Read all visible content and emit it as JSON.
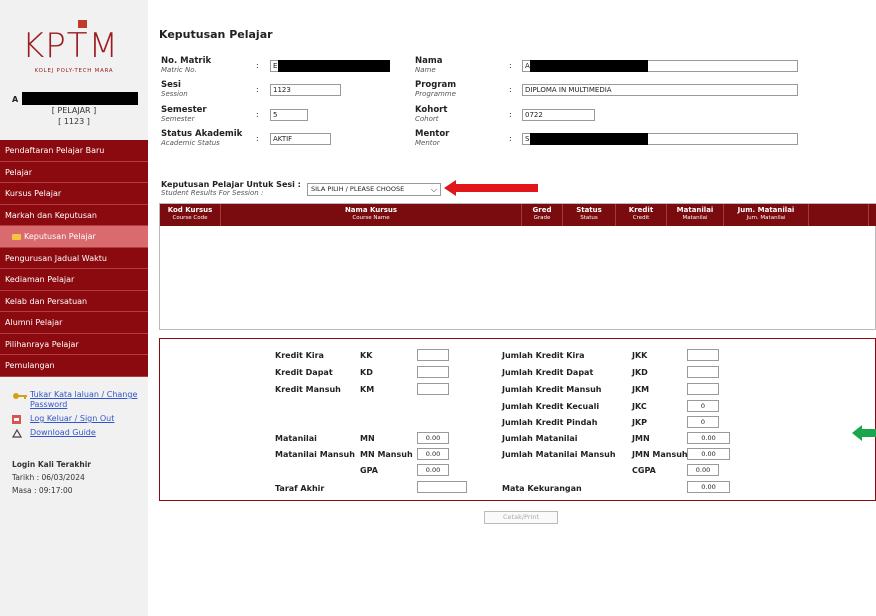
{
  "app": {
    "logo_text": "KPTM",
    "logo_sub": "KOLEJ POLY-TECH MARA"
  },
  "user": {
    "prefix": "A",
    "role": "[ PELAJAR ]",
    "session": "[ 1123 ]"
  },
  "nav": {
    "items": [
      {
        "label": "Pendaftaran Pelajar Baru"
      },
      {
        "label": "Pelajar"
      },
      {
        "label": "Kursus Pelajar"
      },
      {
        "label": "Markah dan Keputusan"
      },
      {
        "label": "Keputusan Pelajar"
      },
      {
        "label": "Pengurusan Jadual Waktu"
      },
      {
        "label": "Kediaman Pelajar"
      },
      {
        "label": "Kelab dan Persatuan"
      },
      {
        "label": "Alumni Pelajar"
      },
      {
        "label": "Pilihanraya Pelajar"
      },
      {
        "label": "Pemulangan"
      }
    ],
    "active_index": 4
  },
  "links": {
    "change_password": "Tukar Kata laluan / Change Password",
    "logout": "Log Keluar / Sign Out",
    "guide": "Download Guide"
  },
  "last_login": {
    "title": "Login Kali Terakhir",
    "date_label": "Tarikh",
    "date": ": 06/03/2024",
    "time_label": "Masa",
    "time": ": 09:17:00"
  },
  "page": {
    "title": "Keputusan Pelajar"
  },
  "profile": {
    "matrik": {
      "label": "No. Matrik",
      "sub": "Matric No.",
      "value": "E"
    },
    "sesi": {
      "label": "Sesi",
      "sub": "Session",
      "value": "1123"
    },
    "semester": {
      "label": "Semester",
      "sub": "Semester",
      "value": "5"
    },
    "status": {
      "label": "Status Akademik",
      "sub": "Academic Status",
      "value": "AKTIF"
    },
    "nama": {
      "label": "Nama",
      "sub": "Name",
      "value": "A"
    },
    "program": {
      "label": "Program",
      "sub": "Programme",
      "value": "DIPLOMA IN MULTIMEDIA"
    },
    "kohort": {
      "label": "Kohort",
      "sub": "Cohort",
      "value": "0722"
    },
    "mentor": {
      "label": "Mentor",
      "sub": "Mentor",
      "value": "S"
    },
    "colon": ":"
  },
  "session_select": {
    "label": "Keputusan Pelajar Untuk Sesi :",
    "sub": "Student Results For Session :",
    "selected": "SILA PILIH / PLEASE CHOOSE"
  },
  "results_table": {
    "columns": [
      {
        "label": "Kod Kursus",
        "sub": "Course Code"
      },
      {
        "label": "Nama Kursus",
        "sub": "Course Name"
      },
      {
        "label": "Gred",
        "sub": "Grade"
      },
      {
        "label": "Status",
        "sub": "Status"
      },
      {
        "label": "Kredit",
        "sub": "Credit"
      },
      {
        "label": "Matanilai",
        "sub": "Matanilai"
      },
      {
        "label": "Jum. Matanilai",
        "sub": "Jum. Matanilai"
      }
    ],
    "rows": []
  },
  "summary": {
    "left": [
      {
        "label": "Kredit Kira",
        "code": "KK",
        "value": ""
      },
      {
        "label": "Kredit Dapat",
        "code": "KD",
        "value": ""
      },
      {
        "label": "Kredit Mansuh",
        "code": "KM",
        "value": ""
      },
      {
        "label": "Matanilai",
        "code": "MN",
        "value": "0.00"
      },
      {
        "label": "Matanilai Mansuh",
        "code": "MN Mansuh",
        "value": "0.00"
      },
      {
        "label": "",
        "code": "GPA",
        "value": "0.00"
      },
      {
        "label": "Taraf Akhir",
        "code": "",
        "value": ""
      }
    ],
    "right": [
      {
        "label": "Jumlah Kredit Kira",
        "code": "JKK",
        "value": ""
      },
      {
        "label": "Jumlah Kredit Dapat",
        "code": "JKD",
        "value": ""
      },
      {
        "label": "Jumlah Kredit Mansuh",
        "code": "JKM",
        "value": ""
      },
      {
        "label": "Jumlah Kredit Kecuali",
        "code": "JKC",
        "value": "0"
      },
      {
        "label": "Jumlah Kredit Pindah",
        "code": "JKP",
        "value": "0"
      },
      {
        "label": "Jumlah Matanilai",
        "code": "JMN",
        "value": "0.00"
      },
      {
        "label": "Jumlah Matanilai Mansuh",
        "code": "JMN Mansuh",
        "value": "0.00"
      },
      {
        "label": "",
        "code": "CGPA",
        "value": "0.00"
      },
      {
        "label": "Mata Kekurangan",
        "code": "",
        "value": "0.00"
      }
    ]
  },
  "print_button": "Cetak/Print",
  "colors": {
    "brand": "#8b0a0f",
    "active_nav": "#d96a6d",
    "annotation_red": "#e0161b",
    "annotation_green": "#1aa64a"
  }
}
